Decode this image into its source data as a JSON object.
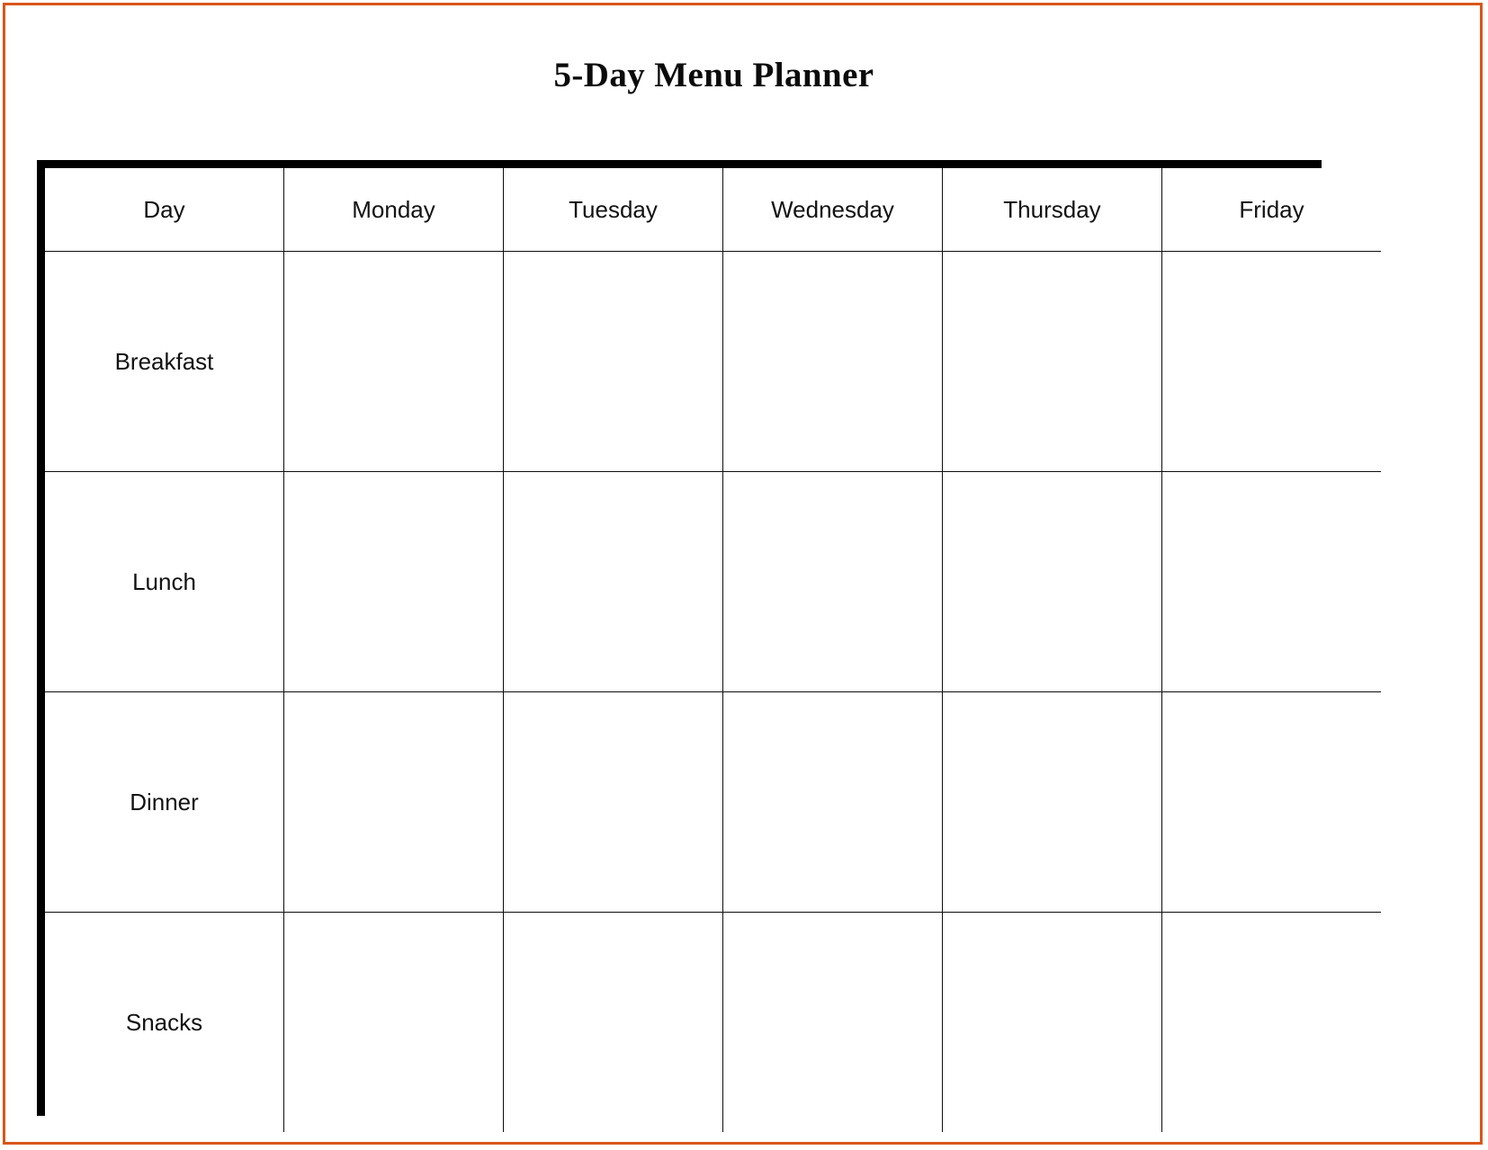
{
  "page": {
    "title": "5-Day Menu Planner",
    "border_color": "#d9561a",
    "table_border_color": "#000000",
    "background_color": "#ffffff"
  },
  "table": {
    "corner_header": "Day",
    "day_columns": [
      {
        "label": "Monday"
      },
      {
        "label": "Tuesday"
      },
      {
        "label": "Wednesday"
      },
      {
        "label": "Thursday"
      },
      {
        "label": "Friday"
      }
    ],
    "meal_rows": [
      {
        "label": "Breakfast",
        "entries": [
          "",
          "",
          "",
          "",
          ""
        ]
      },
      {
        "label": "Lunch",
        "entries": [
          "",
          "",
          "",
          "",
          ""
        ]
      },
      {
        "label": "Dinner",
        "entries": [
          "",
          "",
          "",
          "",
          ""
        ]
      },
      {
        "label": "Snacks",
        "entries": [
          "",
          "",
          "",
          "",
          ""
        ]
      }
    ]
  }
}
